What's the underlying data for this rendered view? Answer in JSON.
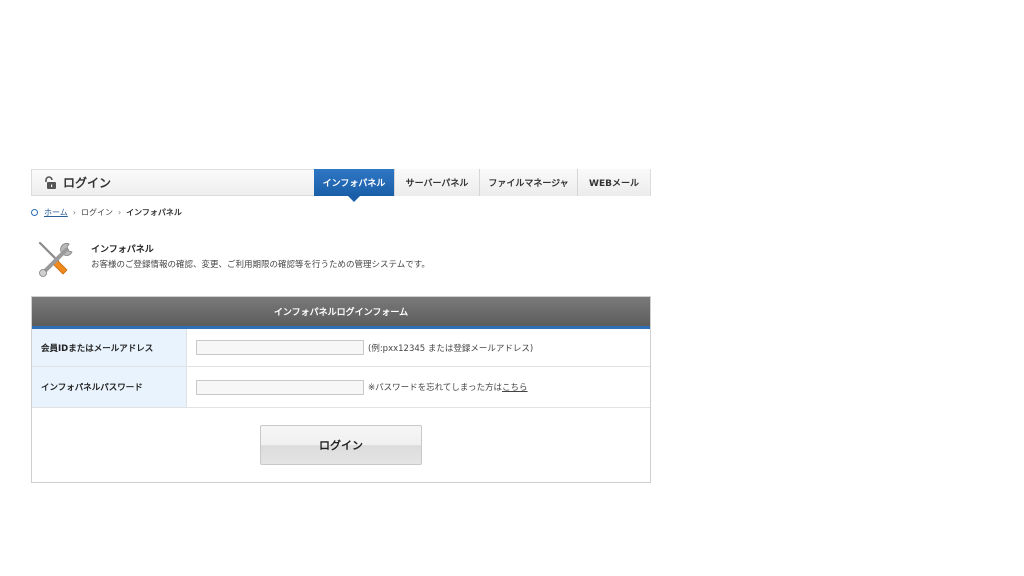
{
  "header": {
    "title": "ログイン",
    "tabs": [
      {
        "label": "インフォパネル",
        "active": true
      },
      {
        "label": "サーバーパネル",
        "active": false
      },
      {
        "label": "ファイルマネージャ",
        "active": false
      },
      {
        "label": "WEBメール",
        "active": false
      }
    ]
  },
  "breadcrumb": {
    "home": "ホーム",
    "login": "ログイン",
    "current": "インフォパネル",
    "separator": "›"
  },
  "info": {
    "name": "インフォパネル",
    "description": "お客様のご登録情報の確認、変更、ご利用期限の確認等を行うための管理システムです。",
    "icon": "wrench-screwdriver-icon"
  },
  "form": {
    "title": "インフォパネルログインフォーム",
    "member_id": {
      "label": "会員IDまたはメールアドレス",
      "value": "",
      "hint": "(例:pxx12345 または登録メールアドレス)"
    },
    "password": {
      "label": "インフォパネルパスワード",
      "value": "",
      "forgot_text": "※パスワードを忘れてしまった方は",
      "forgot_link": "こちら"
    },
    "submit_label": "ログイン"
  },
  "colors": {
    "accent": "#1a5ea8",
    "form_header": "#666666",
    "label_bg": "#e8f3fd"
  }
}
